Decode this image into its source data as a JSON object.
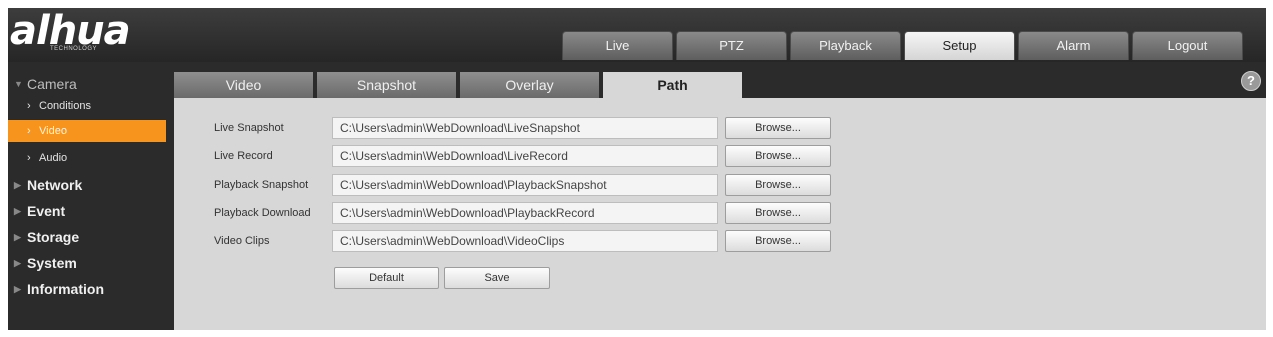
{
  "logo": {
    "main": "alhua",
    "sub": "TECHNOLOGY"
  },
  "top_nav": [
    "Live",
    "PTZ",
    "Playback",
    "Setup",
    "Alarm",
    "Logout"
  ],
  "sidebar": {
    "camera": "Camera",
    "camera_items": [
      "Conditions",
      "Video",
      "Audio"
    ],
    "groups": [
      "Network",
      "Event",
      "Storage",
      "System",
      "Information"
    ]
  },
  "tabs": [
    "Video",
    "Snapshot",
    "Overlay",
    "Path"
  ],
  "help_glyph": "?",
  "rows": [
    {
      "label": "Live Snapshot",
      "path": "C:\\Users\\admin\\WebDownload\\LiveSnapshot",
      "button": "Browse..."
    },
    {
      "label": "Live Record",
      "path": "C:\\Users\\admin\\WebDownload\\LiveRecord",
      "button": "Browse..."
    },
    {
      "label": "Playback Snapshot",
      "path": "C:\\Users\\admin\\WebDownload\\PlaybackSnapshot",
      "button": "Browse..."
    },
    {
      "label": "Playback Download",
      "path": "C:\\Users\\admin\\WebDownload\\PlaybackRecord",
      "button": "Browse..."
    },
    {
      "label": "Video Clips",
      "path": "C:\\Users\\admin\\WebDownload\\VideoClips",
      "button": "Browse..."
    }
  ],
  "actions": {
    "default": "Default",
    "save": "Save"
  },
  "colors": {
    "accent": "#f7941d",
    "panel": "#d7d7d7",
    "background": "#2b2b2b"
  }
}
